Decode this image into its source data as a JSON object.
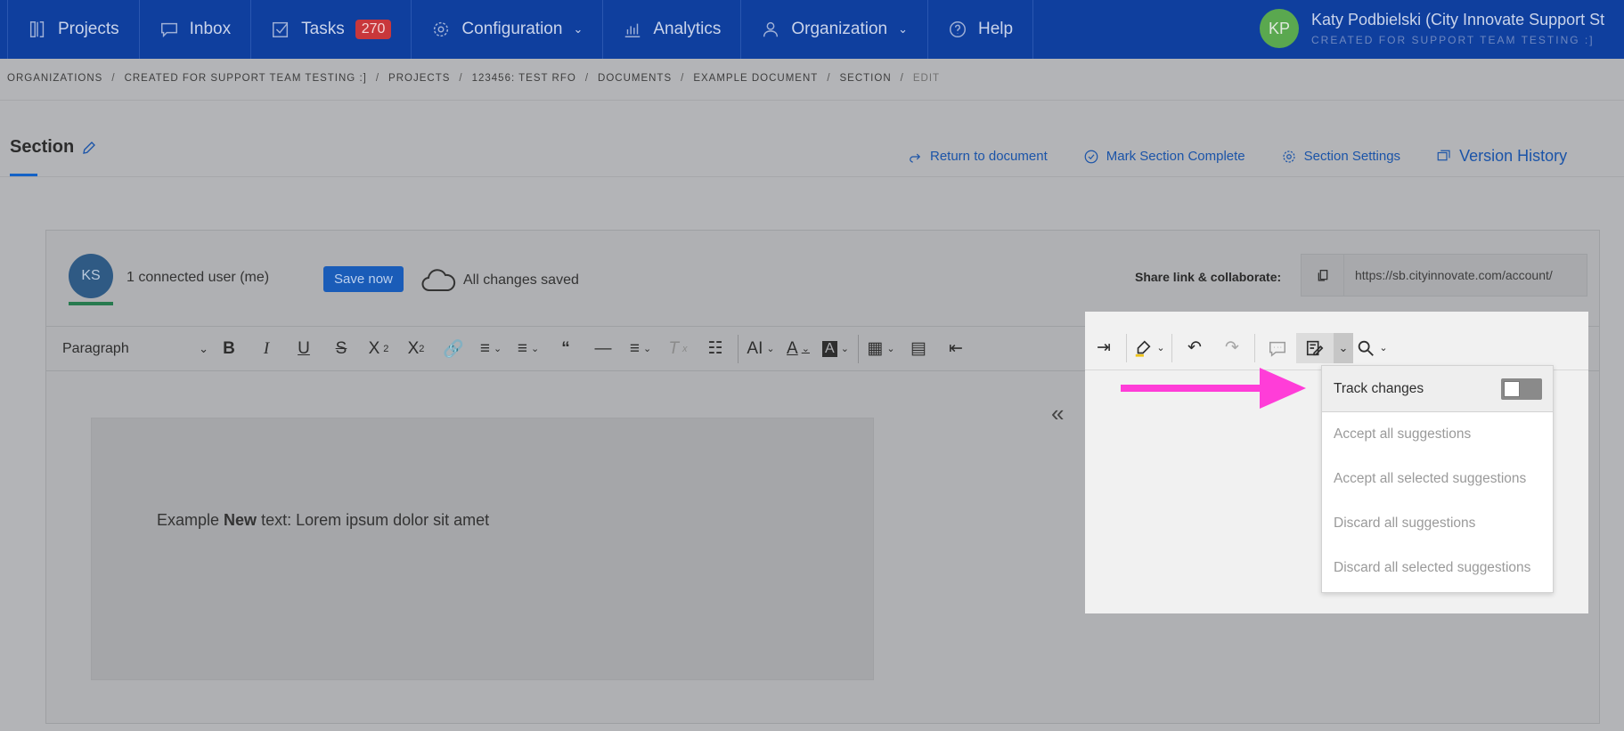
{
  "nav": {
    "projects": "Projects",
    "inbox": "Inbox",
    "tasks": "Tasks",
    "tasks_count": "270",
    "configuration": "Configuration",
    "analytics": "Analytics",
    "organization": "Organization",
    "help": "Help"
  },
  "user": {
    "initials": "KP",
    "name": "Katy Podbielski (City Innovate Support St",
    "org": "CREATED FOR SUPPORT TEAM TESTING :]",
    "avatar_color": "#5aa84f"
  },
  "breadcrumb": [
    "ORGANIZATIONS",
    "CREATED FOR SUPPORT TEAM TESTING :]",
    "PROJECTS",
    "123456: TEST RFO",
    "DOCUMENTS",
    "EXAMPLE DOCUMENT",
    "SECTION",
    "EDIT"
  ],
  "section": {
    "title": "Section",
    "return_label": "Return to document",
    "complete_label": "Mark Section Complete",
    "settings_label": "Section Settings",
    "history_label": "Version History"
  },
  "collab": {
    "initials": "KS",
    "connected": "1 connected user (me)",
    "save_label": "Save now",
    "saved_status": "All changes saved",
    "share_label": "Share link & collaborate:",
    "share_url": "https://sb.cityinnovate.com/account/"
  },
  "toolbar": {
    "paragraph": "Paragraph"
  },
  "document": {
    "text_before": "Example ",
    "text_bold": "New",
    "text_after": " text: Lorem ipsum dolor sit amet"
  },
  "menu": {
    "track_changes": "Track changes",
    "accept_all": "Accept all suggestions",
    "accept_selected": "Accept all selected suggestions",
    "discard_all": "Discard all suggestions",
    "discard_selected": "Discard all selected suggestions",
    "track_changes_on": false
  },
  "colors": {
    "nav_bg": "#0f3f9e",
    "accent": "#1462c6",
    "arrow": "#ff3dd8",
    "badge": "#c8373b"
  }
}
